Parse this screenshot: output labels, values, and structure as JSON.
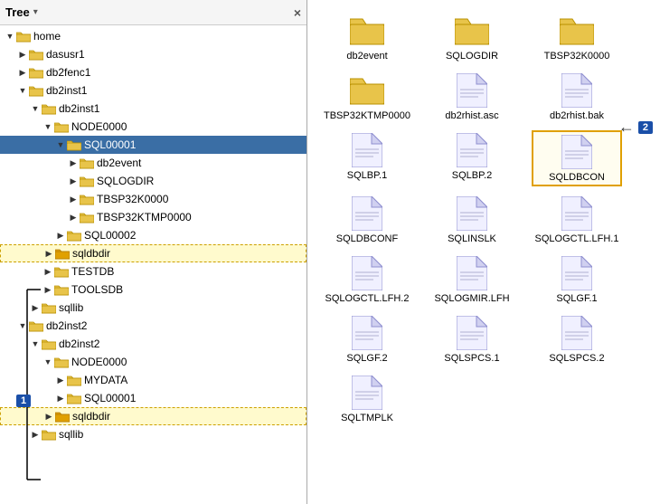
{
  "header": {
    "title": "Tree",
    "close_label": "×",
    "dropdown_arrow": "▾"
  },
  "tree": {
    "nodes": [
      {
        "id": "home",
        "label": "home",
        "level": 0,
        "expanded": true,
        "type": "folder-open",
        "selected": false
      },
      {
        "id": "dasusr1",
        "label": "dasusr1",
        "level": 1,
        "expanded": false,
        "type": "folder",
        "selected": false
      },
      {
        "id": "db2fenc1",
        "label": "db2fenc1",
        "level": 1,
        "expanded": false,
        "type": "folder",
        "selected": false
      },
      {
        "id": "db2inst1",
        "label": "db2inst1",
        "level": 1,
        "expanded": true,
        "type": "folder-open",
        "selected": false
      },
      {
        "id": "db2inst1-sub",
        "label": "db2inst1",
        "level": 2,
        "expanded": true,
        "type": "folder-open",
        "selected": false
      },
      {
        "id": "node0000-1",
        "label": "NODE0000",
        "level": 3,
        "expanded": true,
        "type": "folder-open",
        "selected": false
      },
      {
        "id": "sql00001-1",
        "label": "SQL00001",
        "level": 4,
        "expanded": true,
        "type": "folder-open",
        "selected": true
      },
      {
        "id": "db2event-1",
        "label": "db2event",
        "level": 5,
        "expanded": false,
        "type": "folder",
        "selected": false
      },
      {
        "id": "sqlogdir-1",
        "label": "SQLOGDIR",
        "level": 5,
        "expanded": false,
        "type": "folder",
        "selected": false
      },
      {
        "id": "tbsp32k-1",
        "label": "TBSP32K0000",
        "level": 5,
        "expanded": false,
        "type": "folder",
        "selected": false
      },
      {
        "id": "tbsp32ktmp-1",
        "label": "TBSP32KTMP0000",
        "level": 5,
        "expanded": false,
        "type": "folder",
        "selected": false
      },
      {
        "id": "sql00002",
        "label": "SQL00002",
        "level": 4,
        "expanded": false,
        "type": "folder",
        "selected": false
      },
      {
        "id": "sqldbdir-1",
        "label": "sqldbdir",
        "level": 3,
        "expanded": false,
        "type": "folder",
        "selected": false,
        "highlighted": true
      },
      {
        "id": "testdb",
        "label": "TESTDB",
        "level": 3,
        "expanded": false,
        "type": "folder",
        "selected": false
      },
      {
        "id": "toolsdb",
        "label": "TOOLSDB",
        "level": 3,
        "expanded": false,
        "type": "folder",
        "selected": false
      },
      {
        "id": "sqllib-1",
        "label": "sqllib",
        "level": 2,
        "expanded": false,
        "type": "folder",
        "selected": false
      },
      {
        "id": "db2inst2",
        "label": "db2inst2",
        "level": 1,
        "expanded": true,
        "type": "folder-open",
        "selected": false
      },
      {
        "id": "db2inst2-sub",
        "label": "db2inst2",
        "level": 2,
        "expanded": true,
        "type": "folder-open",
        "selected": false
      },
      {
        "id": "node0000-2",
        "label": "NODE0000",
        "level": 3,
        "expanded": true,
        "type": "folder-open",
        "selected": false
      },
      {
        "id": "mydata",
        "label": "MYDATA",
        "level": 4,
        "expanded": false,
        "type": "folder",
        "selected": false
      },
      {
        "id": "sql00001-2",
        "label": "SQL00001",
        "level": 4,
        "expanded": false,
        "type": "folder",
        "selected": false
      },
      {
        "id": "sqldbdir-2",
        "label": "sqldbdir",
        "level": 3,
        "expanded": false,
        "type": "folder",
        "selected": false,
        "highlighted": true
      },
      {
        "id": "sqllib-2",
        "label": "sqllib",
        "level": 2,
        "expanded": false,
        "type": "folder",
        "selected": false
      }
    ]
  },
  "files": [
    {
      "name": "db2event",
      "type": "folder"
    },
    {
      "name": "SQLOGDIR",
      "type": "folder"
    },
    {
      "name": "TBSP32K0000",
      "type": "folder"
    },
    {
      "name": "TBSP32KTMP0000",
      "type": "folder"
    },
    {
      "name": "db2rhist.asc",
      "type": "file"
    },
    {
      "name": "db2rhist.bak",
      "type": "file"
    },
    {
      "name": "SQLBP.1",
      "type": "file"
    },
    {
      "name": "SQLBP.2",
      "type": "file"
    },
    {
      "name": "SQLDBCON",
      "type": "file",
      "selected": true
    },
    {
      "name": "SQLDBCONF",
      "type": "file"
    },
    {
      "name": "SQLINSLK",
      "type": "file"
    },
    {
      "name": "SQLOGCTL.LFH.1",
      "type": "file"
    },
    {
      "name": "SQLOGCTL.LFH.2",
      "type": "file"
    },
    {
      "name": "SQLOGMIR.LFH",
      "type": "file"
    },
    {
      "name": "SQLGF.1",
      "type": "file"
    },
    {
      "name": "SQLGF.2",
      "type": "file"
    },
    {
      "name": "SQLSPCS.1",
      "type": "file"
    },
    {
      "name": "SQLSPCS.2",
      "type": "file"
    },
    {
      "name": "SQLTMPLK",
      "type": "file"
    }
  ],
  "annotations": {
    "badge1": "1",
    "badge2": "2"
  }
}
